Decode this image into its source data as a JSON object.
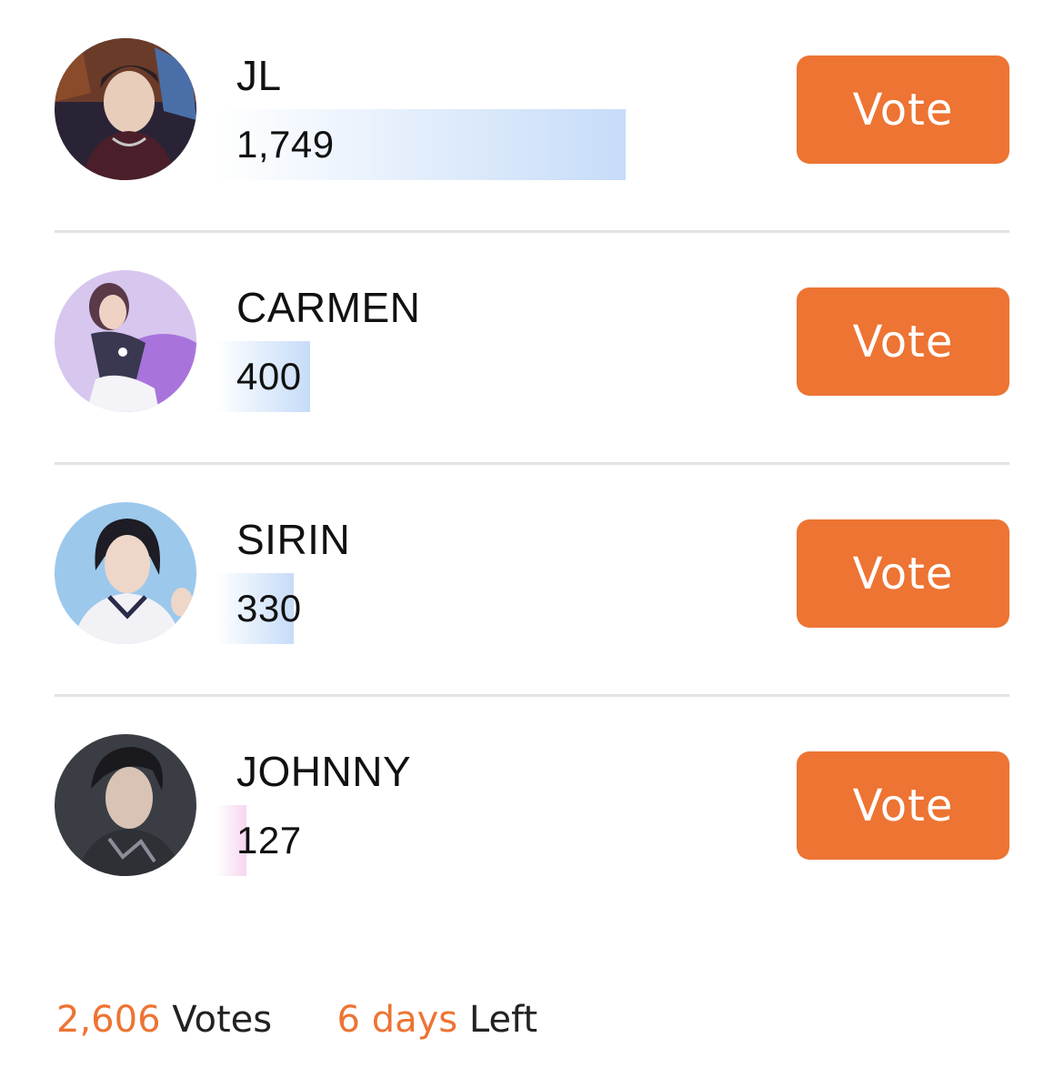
{
  "poll": {
    "candidates": [
      {
        "name": "JL",
        "votes_label": "1,749",
        "votes": 1749,
        "share": 0.671,
        "bar_color": "#c6dcf8",
        "button": "Vote",
        "avatar": "avatar-photo-jl"
      },
      {
        "name": "CARMEN",
        "votes_label": "400",
        "votes": 400,
        "share": 0.153,
        "bar_color": "#c6dcf8",
        "button": "Vote",
        "avatar": "avatar-photo-carmen"
      },
      {
        "name": "SIRIN",
        "votes_label": "330",
        "votes": 330,
        "share": 0.127,
        "bar_color": "#c6dcf8",
        "button": "Vote",
        "avatar": "avatar-photo-sirin"
      },
      {
        "name": "JOHNNY",
        "votes_label": "127",
        "votes": 127,
        "share": 0.049,
        "bar_color": "#f6d6f0",
        "button": "Vote",
        "avatar": "avatar-photo-johnny"
      }
    ]
  },
  "footer": {
    "total_votes": "2,606",
    "votes_label": "Votes",
    "days_left": "6 days",
    "left_label": "Left"
  },
  "colors": {
    "accent": "#ed7433",
    "divider": "#e3e3e3"
  }
}
